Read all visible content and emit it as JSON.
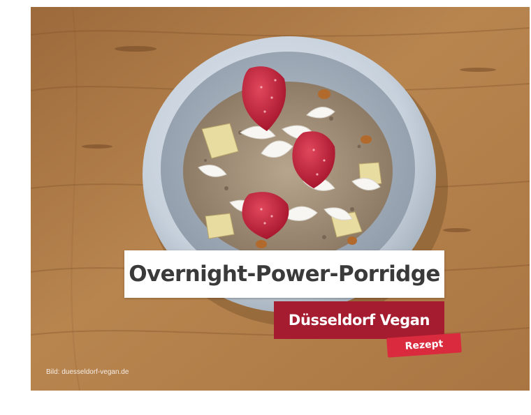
{
  "image": {
    "title": "Overnight-Power-Porridge",
    "brand": "Düsseldorf Vegan",
    "tag": "Rezept",
    "credit": "Bild: duesseldorf-vegan.de"
  },
  "colors": {
    "title_bg": "#ffffff",
    "title_text": "#3a3a3a",
    "brand_bg": "#a51c30",
    "tag_bg": "#d92a3e",
    "wood": "#b07f4d",
    "bowl": "#c9d2dd"
  }
}
